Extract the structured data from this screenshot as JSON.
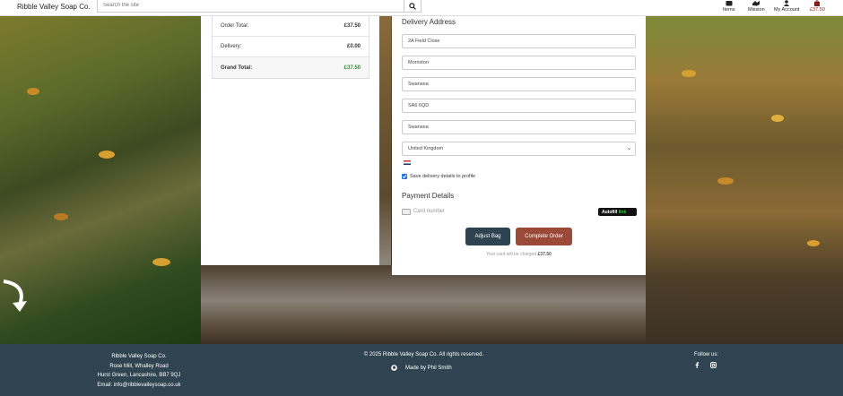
{
  "header": {
    "brand": "Ribble Valley Soap Co.",
    "search_placeholder": "Search the site",
    "nav": {
      "items_label": "Items",
      "mission_label": "Mission",
      "account_label": "My Account",
      "bag_total": "£37.50"
    }
  },
  "order_summary": {
    "rows": [
      {
        "label": "Order Total:",
        "value": "£37.50"
      },
      {
        "label": "Delivery:",
        "value": "£0.00"
      },
      {
        "label": "Grand Total:",
        "value": "£37.50"
      }
    ]
  },
  "delivery": {
    "heading": "Delivery Address",
    "street1": "2A Field Close",
    "street2": "Morriston",
    "county": "Swansea",
    "postcode": "SA6 6QD",
    "town": "Swansea",
    "country": "United Kingdom",
    "save_label": "Save delivery details to profile",
    "save_checked": true
  },
  "payment": {
    "heading": "Payment Details",
    "card_placeholder": "Card number",
    "autofill_text": "Autofill",
    "autofill_link": "link",
    "adjust_label": "Adjust Bag",
    "complete_label": "Complete Order",
    "charge_text": "Your card will be charged",
    "charge_amount": "£37.50"
  },
  "footer": {
    "company": "Ribble Valley Soap Co.",
    "address1": "Rose Mill, Whalley Road",
    "address2": "Hurst Green, Lancashire, BB7 9QJ",
    "email": "Email: info@ribblevalleysoap.co.uk",
    "copyright": "© 2025 Ribble Valley Soap Co. All rights reserved.",
    "made_by": "Made by Phil Smith",
    "follow": "Follow us:"
  },
  "colors": {
    "grand_total": "#2e8b2e",
    "adjust_button": "#2d4450",
    "complete_button": "#9b4a3a",
    "footer_bg": "#2f4450"
  }
}
